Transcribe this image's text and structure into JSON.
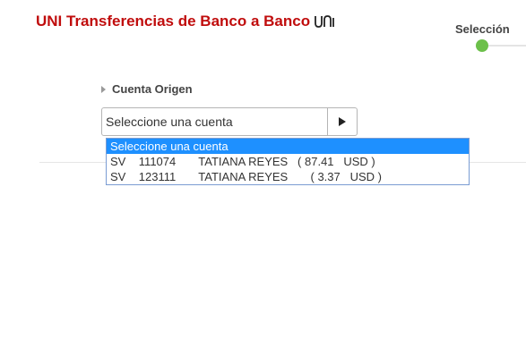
{
  "header": {
    "title": "UNI Transferencias de Banco a Banco",
    "logo_icon": "uni-logo-icon",
    "title_color": "#c00d0d"
  },
  "stepper": {
    "current_step_label": "Selección",
    "active_color": "#6cc04a"
  },
  "form": {
    "origin_account": {
      "label": "Cuenta Origen",
      "selected_value": "Seleccione una cuenta",
      "button_icon": "play-icon",
      "options": [
        {
          "text": "Seleccione una cuenta",
          "highlighted": true
        },
        {
          "text": "SV    111074       TATIANA REYES   ( 87.41   USD )",
          "highlighted": false
        },
        {
          "text": "SV    123111       TATIANA REYES       ( 3.37   USD )",
          "highlighted": false
        }
      ],
      "highlight_color": "#1e90ff"
    }
  }
}
